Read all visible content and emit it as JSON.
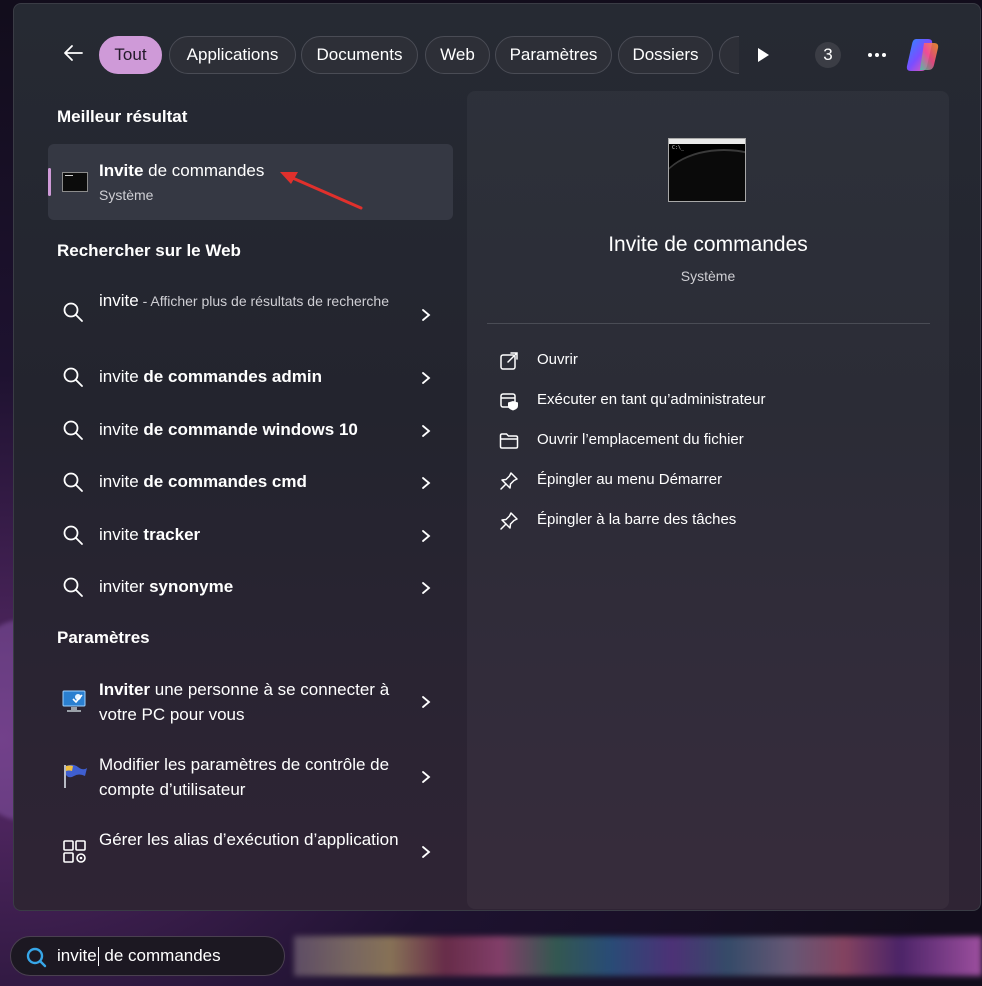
{
  "filters": {
    "tabs": [
      {
        "label": "Tout",
        "active": true
      },
      {
        "label": "Applications"
      },
      {
        "label": "Documents"
      },
      {
        "label": "Web"
      },
      {
        "label": "Paramètres"
      },
      {
        "label": "Dossiers"
      }
    ],
    "count_badge": "3"
  },
  "best_result": {
    "section_title": "Meilleur résultat",
    "title_bold": "Invite",
    "title_rest": " de commandes",
    "subtitle": "Système"
  },
  "web": {
    "section_title": "Rechercher sur le Web",
    "items": [
      {
        "light": "invite",
        "hint": " - Afficher plus de résultats de recherche"
      },
      {
        "light": "invite ",
        "bold": "de commandes admin"
      },
      {
        "light": "invite ",
        "bold": "de commande windows 10"
      },
      {
        "light": "invite ",
        "bold": "de commandes cmd"
      },
      {
        "light": "invite ",
        "bold": "tracker"
      },
      {
        "light": "inviter ",
        "bold": "synonyme"
      }
    ]
  },
  "settings": {
    "section_title": "Paramètres",
    "items": [
      {
        "bold": "Inviter",
        "rest": " une personne à se connecter à votre PC pour vous",
        "icon": "remote-assistance-icon"
      },
      {
        "rest": "Modifier les paramètres de contrôle de compte d’utilisateur",
        "icon": "uac-flag-icon"
      },
      {
        "rest": "Gérer les alias d’exécution d’application",
        "icon": "app-alias-icon"
      }
    ]
  },
  "detail": {
    "title": "Invite de commandes",
    "subtitle": "Système",
    "actions": [
      {
        "label": "Ouvrir",
        "icon": "open-icon"
      },
      {
        "label": "Exécuter en tant qu’administrateur",
        "icon": "admin-shield-icon"
      },
      {
        "label": "Ouvrir l’emplacement du fichier",
        "icon": "folder-icon"
      },
      {
        "label": "Épingler au menu Démarrer",
        "icon": "pin-icon"
      },
      {
        "label": "Épingler à la barre des tâches",
        "icon": "pin-icon"
      }
    ]
  },
  "search": {
    "typed": "invite",
    "rest": " de commandes"
  },
  "colors": {
    "accent": "#cf9ad8",
    "annotation_arrow": "#e0302c"
  }
}
